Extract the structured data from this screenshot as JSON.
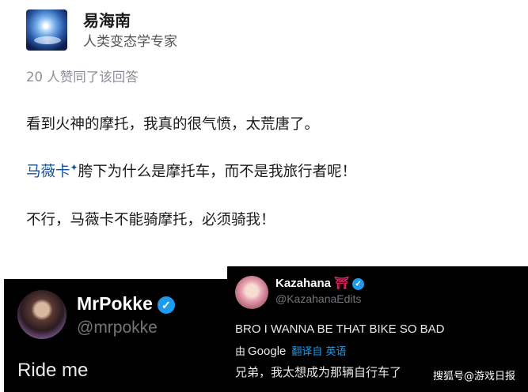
{
  "answer": {
    "author_name": "易海南",
    "author_bio": "人类变态学专家",
    "likes_text": "20 人赞同了该回答",
    "para1": "看到火神的摩托，我真的很气愤，太荒唐了。",
    "para2_link": "马薇卡",
    "para2_spark": "✦",
    "para2_rest": "胯下为什么是摩托车，而不是我旅行者呢！",
    "para3": "不行，马薇卡不能骑摩托，必须骑我！"
  },
  "tweet_left": {
    "name": "MrPokke",
    "verified": "✓",
    "handle": "@mrpokke",
    "text": "Ride me"
  },
  "tweet_right": {
    "name": "Kazahana",
    "emoji": "⛩",
    "verified": "✓",
    "handle": "@KazahanaEdits",
    "text": "BRO I WANNA BE THAT BIKE SO BAD",
    "by_label": "由",
    "google_label": "Google",
    "translate_label": "翻译自 英语",
    "translation": "兄弟，我太想成为那辆自行车了"
  },
  "watermark": "搜狐号@游戏日报",
  "colors": {
    "link": "#175199",
    "twitter_blue": "#1d9bf0",
    "tweet_bg": "#000000"
  },
  "icons": {
    "verified": "verified-badge-icon",
    "torii": "torii-gate-icon",
    "spark": "spark-icon"
  }
}
